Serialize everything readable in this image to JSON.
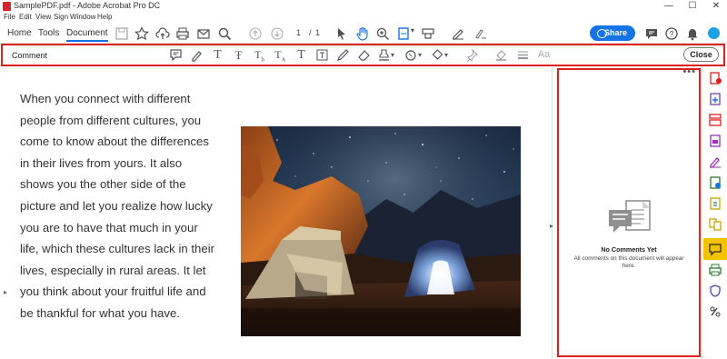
{
  "window": {
    "title": "SamplePDF.pdf - Adobe Acrobat Pro DC",
    "controls": {
      "minimize": "—",
      "maximize": "☐",
      "close": "✕"
    }
  },
  "menu": [
    "File",
    "Edit",
    "View",
    "Sign",
    "Window",
    "Help"
  ],
  "tabs": [
    "Home",
    "Tools",
    "Document"
  ],
  "active_tab": "Document",
  "page_nav": {
    "current": "1",
    "separator": "/",
    "total": "1"
  },
  "share": {
    "label": "Share"
  },
  "comment_toolbar": {
    "label": "Comment",
    "close_label": "Close",
    "tools": [
      "sticky-note",
      "highlight",
      "underline-text",
      "strikethrough",
      "replace-text",
      "insert-text",
      "text-comment",
      "text-box",
      "draw",
      "eraser",
      "stamp",
      "attach-file",
      "shapes",
      "pin",
      "fill-color",
      "line-weight",
      "font"
    ],
    "font_tool_label": "Aa"
  },
  "document": {
    "paragraph": "When you connect with different people from different cultures, you come to know about the differences in their lives from yours. It also shows you the other side of the picture and let you realize how lucky you are to have that much in your life, which these cultures lack in their lives, especially in rural areas. It let you think about your fruitful life and be thankful for what you have."
  },
  "comments_panel": {
    "more_label": "•••",
    "empty_title": "No Comments Yet",
    "empty_subtitle": "All comments on this document will appear here."
  },
  "right_rail": [
    "export-pdf",
    "create-pdf",
    "organize-pages",
    "edit-pdf",
    "fill-sign",
    "request-signature",
    "compress-pdf",
    "combine-files",
    "comment",
    "print-production",
    "protect",
    "more-tools"
  ],
  "colors": {
    "accent": "#1473e6",
    "highlight_border": "#e0201d",
    "active_rail": "#f3c300"
  }
}
